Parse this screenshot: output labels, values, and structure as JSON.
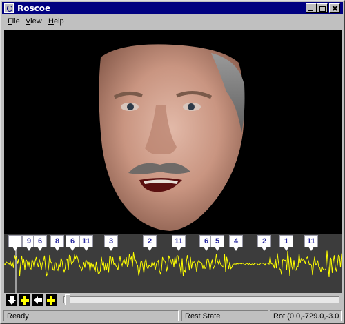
{
  "window": {
    "title": "Roscoe"
  },
  "menu": {
    "items": [
      "File",
      "View",
      "Help"
    ]
  },
  "timeline": {
    "markers": [
      "9",
      "6",
      "8",
      "6",
      "11",
      "3",
      "2",
      "11",
      "6",
      "5",
      "4",
      "2",
      "1",
      "11"
    ],
    "waveform_color": "#ffff00"
  },
  "controls": {
    "buttons": [
      "arrow-down-icon",
      "plus-icon",
      "arrow-left-icon",
      "arrow-right-plus-icon"
    ]
  },
  "status": {
    "left": "Ready",
    "state": "Rest State",
    "rotation": "Rot (0.0,-729.0,-3.0"
  }
}
